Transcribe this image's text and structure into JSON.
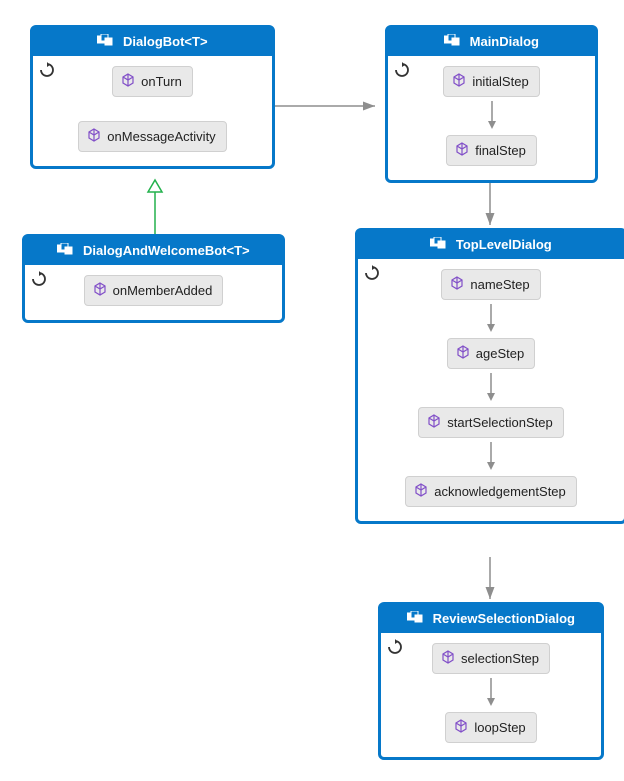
{
  "colors": {
    "primary": "#0678c9",
    "method_bg": "#e9e9e9",
    "cube": "#8250c8",
    "arrow": "#8e8e8e",
    "inherit": "#22b14c"
  },
  "boxes": {
    "dialogBot": {
      "title": "DialogBot<T>",
      "methods": [
        "onTurn",
        "onMessageActivity"
      ]
    },
    "dialogAndWelcome": {
      "title": "DialogAndWelcomeBot<T>",
      "methods": [
        "onMemberAdded"
      ]
    },
    "mainDialog": {
      "title": "MainDialog",
      "methods": [
        "initialStep",
        "finalStep"
      ]
    },
    "topLevel": {
      "title": "TopLevelDialog",
      "methods": [
        "nameStep",
        "ageStep",
        "startSelectionStep",
        "acknowledgementStep"
      ]
    },
    "reviewSel": {
      "title": "ReviewSelectionDialog",
      "methods": [
        "selectionStep",
        "loopStep"
      ]
    }
  }
}
